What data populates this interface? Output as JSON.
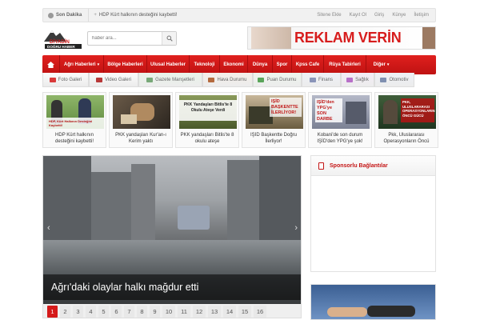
{
  "topbar": {
    "label": "Son Dakika",
    "news": "HDP Kürt halkının desteğini kaybetti!",
    "links": [
      "Sitene Ekle",
      "Kayıt Ol",
      "Giriş",
      "Künye",
      "İletişim"
    ]
  },
  "header": {
    "logo_line1": "DİYADİN",
    "logo_line2": "DOĞRU HABER",
    "search_placeholder": "haber ara...",
    "ad_text": "REKLAM VERİN"
  },
  "mainnav": [
    {
      "label": "Ağrı Haberleri",
      "caret": true
    },
    {
      "label": "Bölge Haberleri",
      "caret": false
    },
    {
      "label": "Ulusal Haberler",
      "caret": false
    },
    {
      "label": "Teknoloji",
      "caret": false
    },
    {
      "label": "Ekonomi",
      "caret": false
    },
    {
      "label": "Dünya",
      "caret": false
    },
    {
      "label": "Spor",
      "caret": false
    },
    {
      "label": "Kpss Cafe",
      "caret": false
    },
    {
      "label": "Rüya Tabirleri",
      "caret": false
    },
    {
      "label": "Diğer",
      "caret": true
    }
  ],
  "subnav": [
    {
      "label": "Foto Galeri",
      "icon": "camera-icon",
      "color": "#d93a3a",
      "bg": "#fbfbfb"
    },
    {
      "label": "Video Galeri",
      "icon": "video-icon",
      "color": "#b83838",
      "bg": "#fbfbfb"
    },
    {
      "label": "Gazete Manşetleri",
      "icon": "newspaper-icon",
      "color": "#78a878",
      "bg": "#e9f4e9"
    },
    {
      "label": "Hava Durumu",
      "icon": "weather-icon",
      "color": "#b46a3e",
      "bg": "#f6efe9"
    },
    {
      "label": "Puan Durumu",
      "icon": "ball-icon",
      "color": "#5aa45a",
      "bg": "#eef6ee"
    },
    {
      "label": "Finans",
      "icon": "finance-icon",
      "color": "#8a94b8",
      "bg": "#eef0f7"
    },
    {
      "label": "Sağlık",
      "icon": "health-icon",
      "color": "#b870c8",
      "bg": "#f4ecf7"
    },
    {
      "label": "Otomotiv",
      "icon": "car-icon",
      "color": "#7f8fb0",
      "bg": "#eef1f7"
    }
  ],
  "thumbs": [
    {
      "caption": "HDP Kürt halkının desteğini kaybetti!",
      "img_text": "HDP, Kürt Halkının Desteğini Kaybetti!"
    },
    {
      "caption": "PKK yandaşları Kur'an-ı Kerim yaktı",
      "img_text": ""
    },
    {
      "caption": "PKK yandaşları Bitlis'te 8 okulu ateşe",
      "img_text": "PKK Yandaşları Bitlis'te 8 Okulu Ateşe Verdi"
    },
    {
      "caption": "IŞİD Başkentte Doğru İlerliyor!",
      "img_text": "IŞİD BAŞKENTTE İLERLİYOR!"
    },
    {
      "caption": "Kobani'de son durum IŞİD'den YPG'ye şok!",
      "img_text": "IŞİD'den YPG'ye SON DARBE"
    },
    {
      "caption": "Pkk, Uluslararası Operasyonların Öncü",
      "img_text": "PKK, ULUSLARARASI OPERASYONLARIN ÖNCÜ GÜCÜ"
    }
  ],
  "slider": {
    "caption": "Ağrı'daki olaylar halkı mağdur etti",
    "pages": [
      "1",
      "2",
      "3",
      "4",
      "5",
      "6",
      "7",
      "8",
      "9",
      "10",
      "11",
      "12",
      "13",
      "14",
      "15",
      "16"
    ],
    "active_page": "1",
    "prev": "‹",
    "next": "›"
  },
  "sidebar": {
    "title": "Sponsorlu Bağlantılar"
  }
}
